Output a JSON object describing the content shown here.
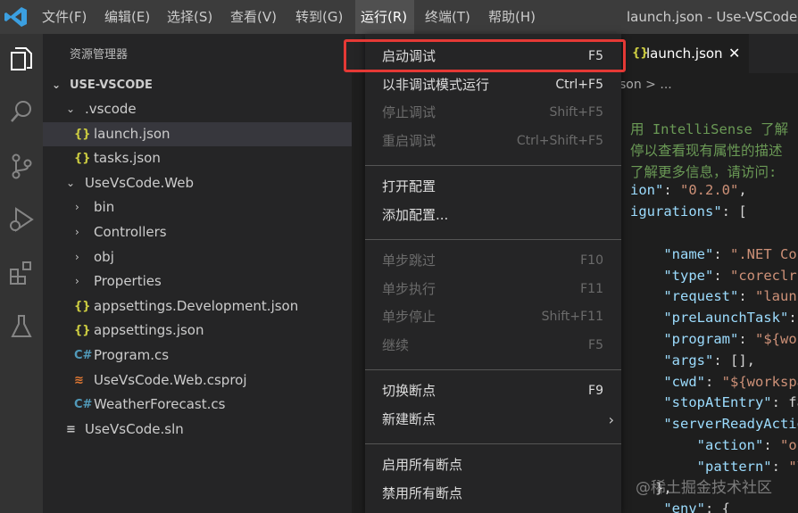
{
  "menubar": {
    "items": [
      "文件(F)",
      "编辑(E)",
      "选择(S)",
      "查看(V)",
      "转到(G)",
      "运行(R)",
      "终端(T)",
      "帮助(H)"
    ],
    "active_index": 5,
    "window_title": "launch.json - Use-VSCode - V"
  },
  "activity_icons": [
    "explorer-icon",
    "search-icon",
    "source-control-icon",
    "run-debug-icon",
    "extensions-icon",
    "testing-icon"
  ],
  "sidebar": {
    "title": "资源管理器",
    "section": "USE-VSCODE",
    "tree": [
      {
        "label": ".vscode",
        "kind": "folder-open"
      },
      {
        "label": "launch.json",
        "kind": "json",
        "selected": true
      },
      {
        "label": "tasks.json",
        "kind": "json"
      },
      {
        "label": "UseVsCode.Web",
        "kind": "folder-open"
      },
      {
        "label": "bin",
        "kind": "folder"
      },
      {
        "label": "Controllers",
        "kind": "folder"
      },
      {
        "label": "obj",
        "kind": "folder"
      },
      {
        "label": "Properties",
        "kind": "folder"
      },
      {
        "label": "appsettings.Development.json",
        "kind": "json"
      },
      {
        "label": "appsettings.json",
        "kind": "json"
      },
      {
        "label": "Program.cs",
        "kind": "cs"
      },
      {
        "label": "UseVsCode.Web.csproj",
        "kind": "rss"
      },
      {
        "label": "WeatherForecast.cs",
        "kind": "cs"
      },
      {
        "label": "UseVsCode.sln",
        "kind": "sln"
      }
    ],
    "icon_glyphs": {
      "json": "{}",
      "cs": "C#",
      "rss": "≋",
      "sln": "≡"
    }
  },
  "editor": {
    "tab_label": "launch.json",
    "breadcrumb": "son > ...",
    "code": [
      [
        [
          "c-comment",
          "用 IntelliSense 了解"
        ]
      ],
      [
        [
          "c-comment",
          "停以查看现有属性的描述"
        ]
      ],
      [
        [
          "c-comment",
          "了解更多信息，请访问: "
        ]
      ],
      [
        [
          "c-key",
          "ion\""
        ],
        [
          "c-punc",
          ": "
        ],
        [
          "c-str",
          "\"0.2.0\""
        ],
        [
          "c-punc",
          ","
        ]
      ],
      [
        [
          "c-key",
          "igurations\""
        ],
        [
          "c-punc",
          ": ["
        ]
      ],
      [
        [
          "c-punc",
          ""
        ]
      ],
      [
        [
          "c-key",
          "    \"name\""
        ],
        [
          "c-punc",
          ": "
        ],
        [
          "c-str",
          "\".NET Cor"
        ]
      ],
      [
        [
          "c-key",
          "    \"type\""
        ],
        [
          "c-punc",
          ": "
        ],
        [
          "c-str",
          "\"coreclr\""
        ]
      ],
      [
        [
          "c-key",
          "    \"request\""
        ],
        [
          "c-punc",
          ": "
        ],
        [
          "c-str",
          "\"launc"
        ]
      ],
      [
        [
          "c-key",
          "    \"preLaunchTask\""
        ],
        [
          "c-punc",
          ": "
        ]
      ],
      [
        [
          "c-key",
          "    \"program\""
        ],
        [
          "c-punc",
          ": "
        ],
        [
          "c-str",
          "\"${wor"
        ]
      ],
      [
        [
          "c-key",
          "    \"args\""
        ],
        [
          "c-punc",
          ": [],"
        ]
      ],
      [
        [
          "c-key",
          "    \"cwd\""
        ],
        [
          "c-punc",
          ": "
        ],
        [
          "c-str",
          "\"${workspa"
        ]
      ],
      [
        [
          "c-key",
          "    \"stopAtEntry\""
        ],
        [
          "c-punc",
          ": fa"
        ]
      ],
      [
        [
          "c-key",
          "    \"serverReadyActio"
        ]
      ],
      [
        [
          "c-key",
          "        \"action\""
        ],
        [
          "c-punc",
          ": "
        ],
        [
          "c-str",
          "\"op"
        ]
      ],
      [
        [
          "c-key",
          "        \"pattern\""
        ],
        [
          "c-punc",
          ": "
        ],
        [
          "c-str",
          "\"\\"
        ]
      ],
      [
        [
          "c-punc",
          "   },"
        ]
      ],
      [
        [
          "c-key",
          "    \"env\""
        ],
        [
          "c-punc",
          ": {"
        ]
      ]
    ]
  },
  "run_menu": {
    "groups": [
      [
        {
          "label": "启动调试",
          "key": "F5",
          "enabled": true
        },
        {
          "label": "以非调试模式运行",
          "key": "Ctrl+F5",
          "enabled": true
        },
        {
          "label": "停止调试",
          "key": "Shift+F5",
          "enabled": false
        },
        {
          "label": "重启调试",
          "key": "Ctrl+Shift+F5",
          "enabled": false
        }
      ],
      [
        {
          "label": "打开配置",
          "key": "",
          "enabled": true
        },
        {
          "label": "添加配置...",
          "key": "",
          "enabled": true
        }
      ],
      [
        {
          "label": "单步跳过",
          "key": "F10",
          "enabled": false
        },
        {
          "label": "单步执行",
          "key": "F11",
          "enabled": false
        },
        {
          "label": "单步停止",
          "key": "Shift+F11",
          "enabled": false
        },
        {
          "label": "继续",
          "key": "F5",
          "enabled": false
        }
      ],
      [
        {
          "label": "切换断点",
          "key": "F9",
          "enabled": true
        },
        {
          "label": "新建断点",
          "key": "",
          "enabled": true,
          "submenu": true
        }
      ],
      [
        {
          "label": "启用所有断点",
          "key": "",
          "enabled": true
        },
        {
          "label": "禁用所有断点",
          "key": "",
          "enabled": true
        }
      ]
    ],
    "highlighted_item": "启动调试"
  },
  "watermark": "@稀土掘金技术社区",
  "colors": {
    "accent": "#007acc",
    "highlight": "#e53935"
  }
}
